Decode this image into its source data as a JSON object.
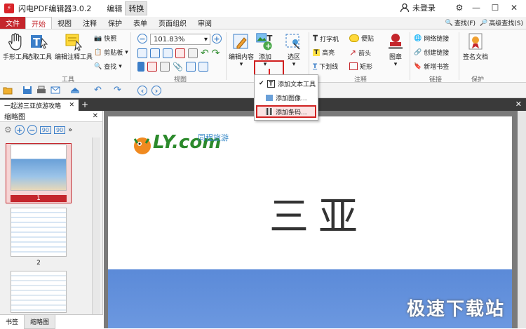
{
  "titlebar": {
    "app_title": "闪电PDF编辑器3.0.2",
    "tabs": [
      "编辑",
      "转换"
    ],
    "user": "未登录"
  },
  "menubar": {
    "items": [
      "文件",
      "开始",
      "视图",
      "注释",
      "保护",
      "表单",
      "页面组织",
      "审阅"
    ],
    "right": [
      "查找(F)",
      "高级查找(S)"
    ]
  },
  "ribbon": {
    "tools": {
      "hand": "手形工具",
      "select": "选取工具",
      "edit_annot": "编辑注释工具",
      "snapshot": "快照",
      "clipboard": "剪贴板",
      "find": "查找",
      "group_label": "工具"
    },
    "view": {
      "zoom": "101.83%",
      "group_label": "视图"
    },
    "edit": {
      "edit_content": "编辑内容",
      "add": "添加",
      "select_area": "选区"
    },
    "annot": {
      "typewriter": "打字机",
      "note": "便贴",
      "highlight": "高亮",
      "arrow": "箭头",
      "underline": "下划线",
      "rect": "矩形",
      "stamp": "图章",
      "group_label": "注释"
    },
    "links": {
      "weblink": "网络链接",
      "create_link": "创建链接",
      "new_bookmark": "新增书签",
      "group_label": "链接"
    },
    "protect": {
      "sign": "签名文档",
      "group_label": "保护"
    }
  },
  "dropdown": {
    "items": [
      "添加文本工具",
      "添加图像...",
      "添加条码..."
    ]
  },
  "document": {
    "tab_title": "一起游三亚旅游攻略",
    "page_heading": "三亚",
    "logo": "LY.com",
    "logo_sub": "同程旅游"
  },
  "sidepanel": {
    "title": "缩略图",
    "pages": [
      "1",
      "2"
    ]
  },
  "bottomtabs": [
    "书签",
    "缩略图"
  ],
  "watermark": "极速下载站",
  "colors": {
    "accent": "#c4262c",
    "highlight": "#d02020"
  }
}
